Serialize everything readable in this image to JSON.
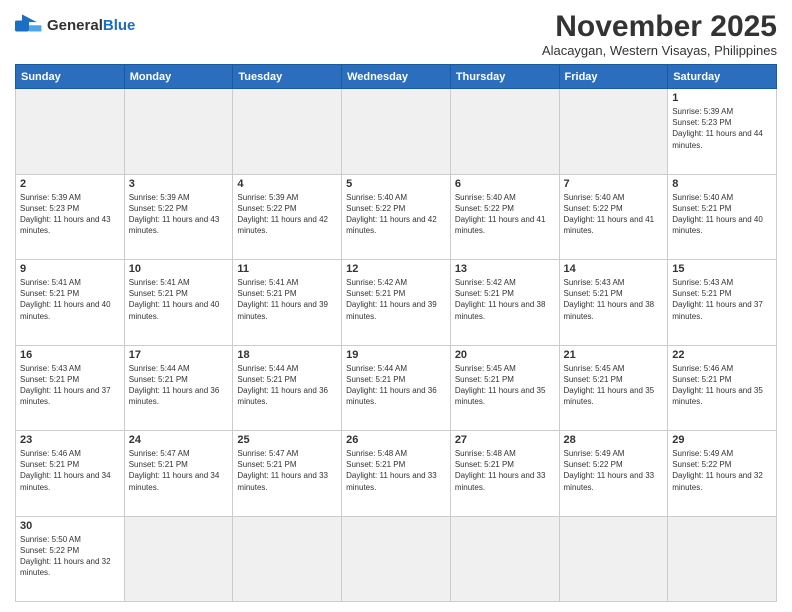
{
  "header": {
    "logo_general": "General",
    "logo_blue": "Blue",
    "month_title": "November 2025",
    "subtitle": "Alacaygan, Western Visayas, Philippines"
  },
  "weekdays": [
    "Sunday",
    "Monday",
    "Tuesday",
    "Wednesday",
    "Thursday",
    "Friday",
    "Saturday"
  ],
  "days": [
    {
      "num": "",
      "sunrise": "",
      "sunset": "",
      "daylight": "",
      "empty": true
    },
    {
      "num": "",
      "sunrise": "",
      "sunset": "",
      "daylight": "",
      "empty": true
    },
    {
      "num": "",
      "sunrise": "",
      "sunset": "",
      "daylight": "",
      "empty": true
    },
    {
      "num": "",
      "sunrise": "",
      "sunset": "",
      "daylight": "",
      "empty": true
    },
    {
      "num": "",
      "sunrise": "",
      "sunset": "",
      "daylight": "",
      "empty": true
    },
    {
      "num": "",
      "sunrise": "",
      "sunset": "",
      "daylight": "",
      "empty": true
    },
    {
      "num": "1",
      "sunrise": "Sunrise: 5:39 AM",
      "sunset": "Sunset: 5:23 PM",
      "daylight": "Daylight: 11 hours and 44 minutes.",
      "empty": false
    },
    {
      "num": "2",
      "sunrise": "Sunrise: 5:39 AM",
      "sunset": "Sunset: 5:23 PM",
      "daylight": "Daylight: 11 hours and 43 minutes.",
      "empty": false
    },
    {
      "num": "3",
      "sunrise": "Sunrise: 5:39 AM",
      "sunset": "Sunset: 5:22 PM",
      "daylight": "Daylight: 11 hours and 43 minutes.",
      "empty": false
    },
    {
      "num": "4",
      "sunrise": "Sunrise: 5:39 AM",
      "sunset": "Sunset: 5:22 PM",
      "daylight": "Daylight: 11 hours and 42 minutes.",
      "empty": false
    },
    {
      "num": "5",
      "sunrise": "Sunrise: 5:40 AM",
      "sunset": "Sunset: 5:22 PM",
      "daylight": "Daylight: 11 hours and 42 minutes.",
      "empty": false
    },
    {
      "num": "6",
      "sunrise": "Sunrise: 5:40 AM",
      "sunset": "Sunset: 5:22 PM",
      "daylight": "Daylight: 11 hours and 41 minutes.",
      "empty": false
    },
    {
      "num": "7",
      "sunrise": "Sunrise: 5:40 AM",
      "sunset": "Sunset: 5:22 PM",
      "daylight": "Daylight: 11 hours and 41 minutes.",
      "empty": false
    },
    {
      "num": "8",
      "sunrise": "Sunrise: 5:40 AM",
      "sunset": "Sunset: 5:21 PM",
      "daylight": "Daylight: 11 hours and 40 minutes.",
      "empty": false
    },
    {
      "num": "9",
      "sunrise": "Sunrise: 5:41 AM",
      "sunset": "Sunset: 5:21 PM",
      "daylight": "Daylight: 11 hours and 40 minutes.",
      "empty": false
    },
    {
      "num": "10",
      "sunrise": "Sunrise: 5:41 AM",
      "sunset": "Sunset: 5:21 PM",
      "daylight": "Daylight: 11 hours and 40 minutes.",
      "empty": false
    },
    {
      "num": "11",
      "sunrise": "Sunrise: 5:41 AM",
      "sunset": "Sunset: 5:21 PM",
      "daylight": "Daylight: 11 hours and 39 minutes.",
      "empty": false
    },
    {
      "num": "12",
      "sunrise": "Sunrise: 5:42 AM",
      "sunset": "Sunset: 5:21 PM",
      "daylight": "Daylight: 11 hours and 39 minutes.",
      "empty": false
    },
    {
      "num": "13",
      "sunrise": "Sunrise: 5:42 AM",
      "sunset": "Sunset: 5:21 PM",
      "daylight": "Daylight: 11 hours and 38 minutes.",
      "empty": false
    },
    {
      "num": "14",
      "sunrise": "Sunrise: 5:43 AM",
      "sunset": "Sunset: 5:21 PM",
      "daylight": "Daylight: 11 hours and 38 minutes.",
      "empty": false
    },
    {
      "num": "15",
      "sunrise": "Sunrise: 5:43 AM",
      "sunset": "Sunset: 5:21 PM",
      "daylight": "Daylight: 11 hours and 37 minutes.",
      "empty": false
    },
    {
      "num": "16",
      "sunrise": "Sunrise: 5:43 AM",
      "sunset": "Sunset: 5:21 PM",
      "daylight": "Daylight: 11 hours and 37 minutes.",
      "empty": false
    },
    {
      "num": "17",
      "sunrise": "Sunrise: 5:44 AM",
      "sunset": "Sunset: 5:21 PM",
      "daylight": "Daylight: 11 hours and 36 minutes.",
      "empty": false
    },
    {
      "num": "18",
      "sunrise": "Sunrise: 5:44 AM",
      "sunset": "Sunset: 5:21 PM",
      "daylight": "Daylight: 11 hours and 36 minutes.",
      "empty": false
    },
    {
      "num": "19",
      "sunrise": "Sunrise: 5:44 AM",
      "sunset": "Sunset: 5:21 PM",
      "daylight": "Daylight: 11 hours and 36 minutes.",
      "empty": false
    },
    {
      "num": "20",
      "sunrise": "Sunrise: 5:45 AM",
      "sunset": "Sunset: 5:21 PM",
      "daylight": "Daylight: 11 hours and 35 minutes.",
      "empty": false
    },
    {
      "num": "21",
      "sunrise": "Sunrise: 5:45 AM",
      "sunset": "Sunset: 5:21 PM",
      "daylight": "Daylight: 11 hours and 35 minutes.",
      "empty": false
    },
    {
      "num": "22",
      "sunrise": "Sunrise: 5:46 AM",
      "sunset": "Sunset: 5:21 PM",
      "daylight": "Daylight: 11 hours and 35 minutes.",
      "empty": false
    },
    {
      "num": "23",
      "sunrise": "Sunrise: 5:46 AM",
      "sunset": "Sunset: 5:21 PM",
      "daylight": "Daylight: 11 hours and 34 minutes.",
      "empty": false
    },
    {
      "num": "24",
      "sunrise": "Sunrise: 5:47 AM",
      "sunset": "Sunset: 5:21 PM",
      "daylight": "Daylight: 11 hours and 34 minutes.",
      "empty": false
    },
    {
      "num": "25",
      "sunrise": "Sunrise: 5:47 AM",
      "sunset": "Sunset: 5:21 PM",
      "daylight": "Daylight: 11 hours and 33 minutes.",
      "empty": false
    },
    {
      "num": "26",
      "sunrise": "Sunrise: 5:48 AM",
      "sunset": "Sunset: 5:21 PM",
      "daylight": "Daylight: 11 hours and 33 minutes.",
      "empty": false
    },
    {
      "num": "27",
      "sunrise": "Sunrise: 5:48 AM",
      "sunset": "Sunset: 5:21 PM",
      "daylight": "Daylight: 11 hours and 33 minutes.",
      "empty": false
    },
    {
      "num": "28",
      "sunrise": "Sunrise: 5:49 AM",
      "sunset": "Sunset: 5:22 PM",
      "daylight": "Daylight: 11 hours and 33 minutes.",
      "empty": false
    },
    {
      "num": "29",
      "sunrise": "Sunrise: 5:49 AM",
      "sunset": "Sunset: 5:22 PM",
      "daylight": "Daylight: 11 hours and 32 minutes.",
      "empty": false
    },
    {
      "num": "30",
      "sunrise": "Sunrise: 5:50 AM",
      "sunset": "Sunset: 5:22 PM",
      "daylight": "Daylight: 11 hours and 32 minutes.",
      "empty": false
    }
  ]
}
